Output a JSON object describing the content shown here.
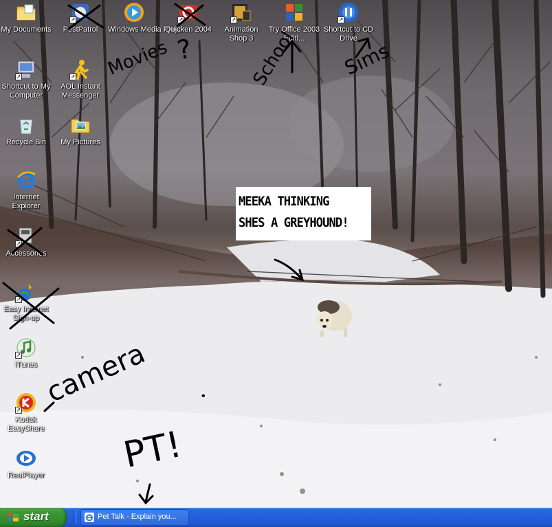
{
  "desktop": {
    "icons": [
      {
        "label": "My Documents",
        "name": "my-documents"
      },
      {
        "label": "PestPatrol",
        "name": "pestpatrol"
      },
      {
        "label": "Windows Media Player",
        "name": "windows-media-player"
      },
      {
        "label": "Quicken 2004",
        "name": "quicken-2004"
      },
      {
        "label": "Animation Shop 3",
        "name": "animation-shop-3"
      },
      {
        "label": "Try Office 2003 Editi...",
        "name": "try-office-2003"
      },
      {
        "label": "Shortcut to CD Drive",
        "name": "shortcut-to-cd-drive"
      },
      {
        "label": "Shortcut to My Computer",
        "name": "shortcut-to-my-computer"
      },
      {
        "label": "AOL Instant Messenger",
        "name": "aol-instant-messenger"
      },
      {
        "label": "Recycle Bin",
        "name": "recycle-bin"
      },
      {
        "label": "My Pictures",
        "name": "my-pictures"
      },
      {
        "label": "Internet Explorer",
        "name": "internet-explorer"
      },
      {
        "label": "Accessories",
        "name": "accessories"
      },
      {
        "label": "Easy Internet Sign-up",
        "name": "easy-internet-signup"
      },
      {
        "label": "iTunes",
        "name": "itunes"
      },
      {
        "label": "Kodak EasyShare",
        "name": "kodak-easyshare"
      },
      {
        "label": "RealPlayer",
        "name": "realplayer"
      }
    ]
  },
  "caption": {
    "line1": "MEEKA THINKING",
    "line2": "SHES A GREYHOUND!"
  },
  "annotations": {
    "movies": "Movies",
    "qmark": "?",
    "school": "School",
    "sims": "Sims",
    "camera": "camera",
    "pt": "PT!"
  },
  "taskbar": {
    "start_label": "start",
    "task_button_label": "Pet Talk - Explain you..."
  },
  "colors": {
    "taskbar_blue": "#245edb",
    "start_green": "#3c9b35",
    "annotation_ink": "#000000"
  }
}
